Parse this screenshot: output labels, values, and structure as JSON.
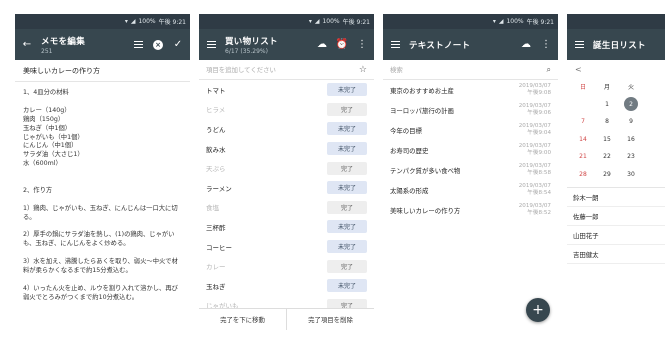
{
  "status": {
    "battery": "100%",
    "time": "午後 9:21"
  },
  "memo": {
    "title": "メモを編集",
    "subtitle": "251",
    "note_title": "美味しいカレーの作り方",
    "body_lines": [
      "1、4皿分の材料",
      "",
      "カレー（140g）",
      "鶏肉（150g）",
      "玉ねぎ（中1個）",
      "じゃがいも（中1個）",
      "にんじん（中1個）",
      "サラダ油（大さじ1）",
      "水（600ml）",
      "",
      "",
      "2、作り方",
      "",
      "1）鶏肉、じゃがいも、玉ねぎ、にんじんは一口大に切る。",
      "",
      "2）厚手の鍋にサラダ油を熱し、(1)の鶏肉、じゃがいも、玉ねぎ、にんじんをよく炒める。",
      "",
      "3）水を加え、沸騰したらあくを取り、弱火〜中火で材料が柔らかくなるまで約15分煮込む。",
      "",
      "4）いったん火を止め、ルウを割り入れて溶かし、再び弱火でとろみがつくまで約10分煮込む。"
    ]
  },
  "shopping": {
    "title": "買い物リスト",
    "subtitle": "6/17 (35.29%)",
    "add_placeholder": "項目を追加してください",
    "items": [
      {
        "name": "トマト",
        "done": false,
        "label": "未完了"
      },
      {
        "name": "ヒラメ",
        "done": true,
        "label": "完了"
      },
      {
        "name": "うどん",
        "done": false,
        "label": "未完了"
      },
      {
        "name": "飲み水",
        "done": false,
        "label": "未完了"
      },
      {
        "name": "天ぷら",
        "done": true,
        "label": "完了"
      },
      {
        "name": "ラーメン",
        "done": false,
        "label": "未完了"
      },
      {
        "name": "食塩",
        "done": true,
        "label": "完了"
      },
      {
        "name": "三杯酢",
        "done": false,
        "label": "未完了"
      },
      {
        "name": "コーヒー",
        "done": false,
        "label": "未完了"
      },
      {
        "name": "カレー",
        "done": true,
        "label": "完了"
      },
      {
        "name": "玉ねぎ",
        "done": false,
        "label": "未完了"
      },
      {
        "name": "じゃがいも",
        "done": true,
        "label": "完了"
      }
    ],
    "bottom_left": "完了を下に移動",
    "bottom_right": "完了項目を削除"
  },
  "notes": {
    "title": "テキストノート",
    "search_placeholder": "検索",
    "items": [
      {
        "title": "東京のおすすめお土産",
        "date": "2019/03/07",
        "time": "午後9:08"
      },
      {
        "title": "ヨーロッパ旅行の計画",
        "date": "2019/03/07",
        "time": "午後9:06"
      },
      {
        "title": "今年の目標",
        "date": "2019/03/07",
        "time": "午後9:04"
      },
      {
        "title": "お寿司の歴史",
        "date": "2019/03/07",
        "time": "午後9:00"
      },
      {
        "title": "テンパク質が多い食べ物",
        "date": "2019/03/07",
        "time": "午後8:58"
      },
      {
        "title": "太陽系の形成",
        "date": "2019/03/07",
        "time": "午後8:54"
      },
      {
        "title": "美味しいカレーの作り方",
        "date": "2019/03/07",
        "time": "午後8:52"
      }
    ],
    "fab": "+"
  },
  "birthday": {
    "title": "誕生日リスト",
    "prev": "<",
    "weekdays": [
      "日",
      "月",
      "火"
    ],
    "weeks": [
      [
        "",
        "1",
        "2"
      ],
      [
        "7",
        "8",
        "9"
      ],
      [
        "14",
        "15",
        "16"
      ],
      [
        "21",
        "22",
        "23"
      ],
      [
        "28",
        "29",
        "30"
      ]
    ],
    "selected": "2",
    "people": [
      "鈴木一朗",
      "佐藤一郎",
      "山田花子",
      "吉田健太"
    ]
  }
}
